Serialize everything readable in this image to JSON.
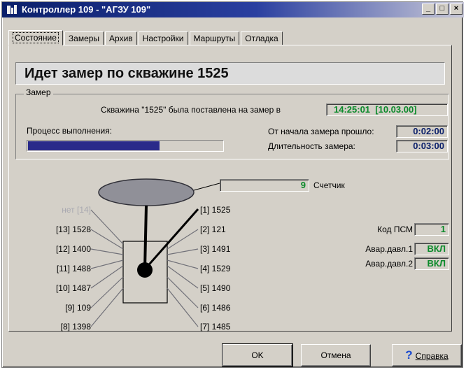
{
  "window": {
    "title": "Контроллер 109 - \"АГЗУ 109\"",
    "buttons": [
      "_",
      "□",
      "×"
    ]
  },
  "tabs": [
    {
      "label": "Состояние",
      "active": true
    },
    {
      "label": "Замеры",
      "active": false
    },
    {
      "label": "Архив",
      "active": false
    },
    {
      "label": "Настройки",
      "active": false
    },
    {
      "label": "Маршруты",
      "active": false
    },
    {
      "label": "Отладка",
      "active": false
    }
  ],
  "status_message": "Идет замер по скважине 1525",
  "measurement": {
    "group_label": "Замер",
    "well_label": "Скважина \"1525\" была поставлена на замер в",
    "start_time": "14:25:01",
    "start_date": "[10.03.00]",
    "progress_label": "Процесс выполнения:",
    "progress_fraction": 0.67,
    "elapsed_label": "От начала замера прошло:",
    "elapsed_value": "0:02:00",
    "duration_label": "Длительность замера:",
    "duration_value": "0:03:00"
  },
  "counter": {
    "value": "9",
    "label": "Счетчик"
  },
  "switch_outputs": {
    "left": [
      "нет [14]",
      "[13] 1528",
      "[12] 1400",
      "[11] 1488",
      "[10] 1487",
      "[9] 109",
      "[8] 1398"
    ],
    "right": [
      "[1] 1525",
      "[2] 121",
      "[3] 1491",
      "[4] 1529",
      "[5] 1490",
      "[6] 1486",
      "[7] 1485"
    ],
    "active_output": "[1] 1525"
  },
  "indicators": [
    {
      "label": "Код ПСМ",
      "value": "1",
      "color": "#0a8a2a"
    },
    {
      "label": "Авар.давл.1",
      "value": "ВКЛ",
      "color": "#0a8a2a"
    },
    {
      "label": "Авар.давл.2",
      "value": "ВКЛ",
      "color": "#0a8a2a"
    }
  ],
  "buttons": {
    "ok": "OK",
    "cancel": "Отмена",
    "help": "Справка",
    "help_icon": "question-mark-icon"
  }
}
